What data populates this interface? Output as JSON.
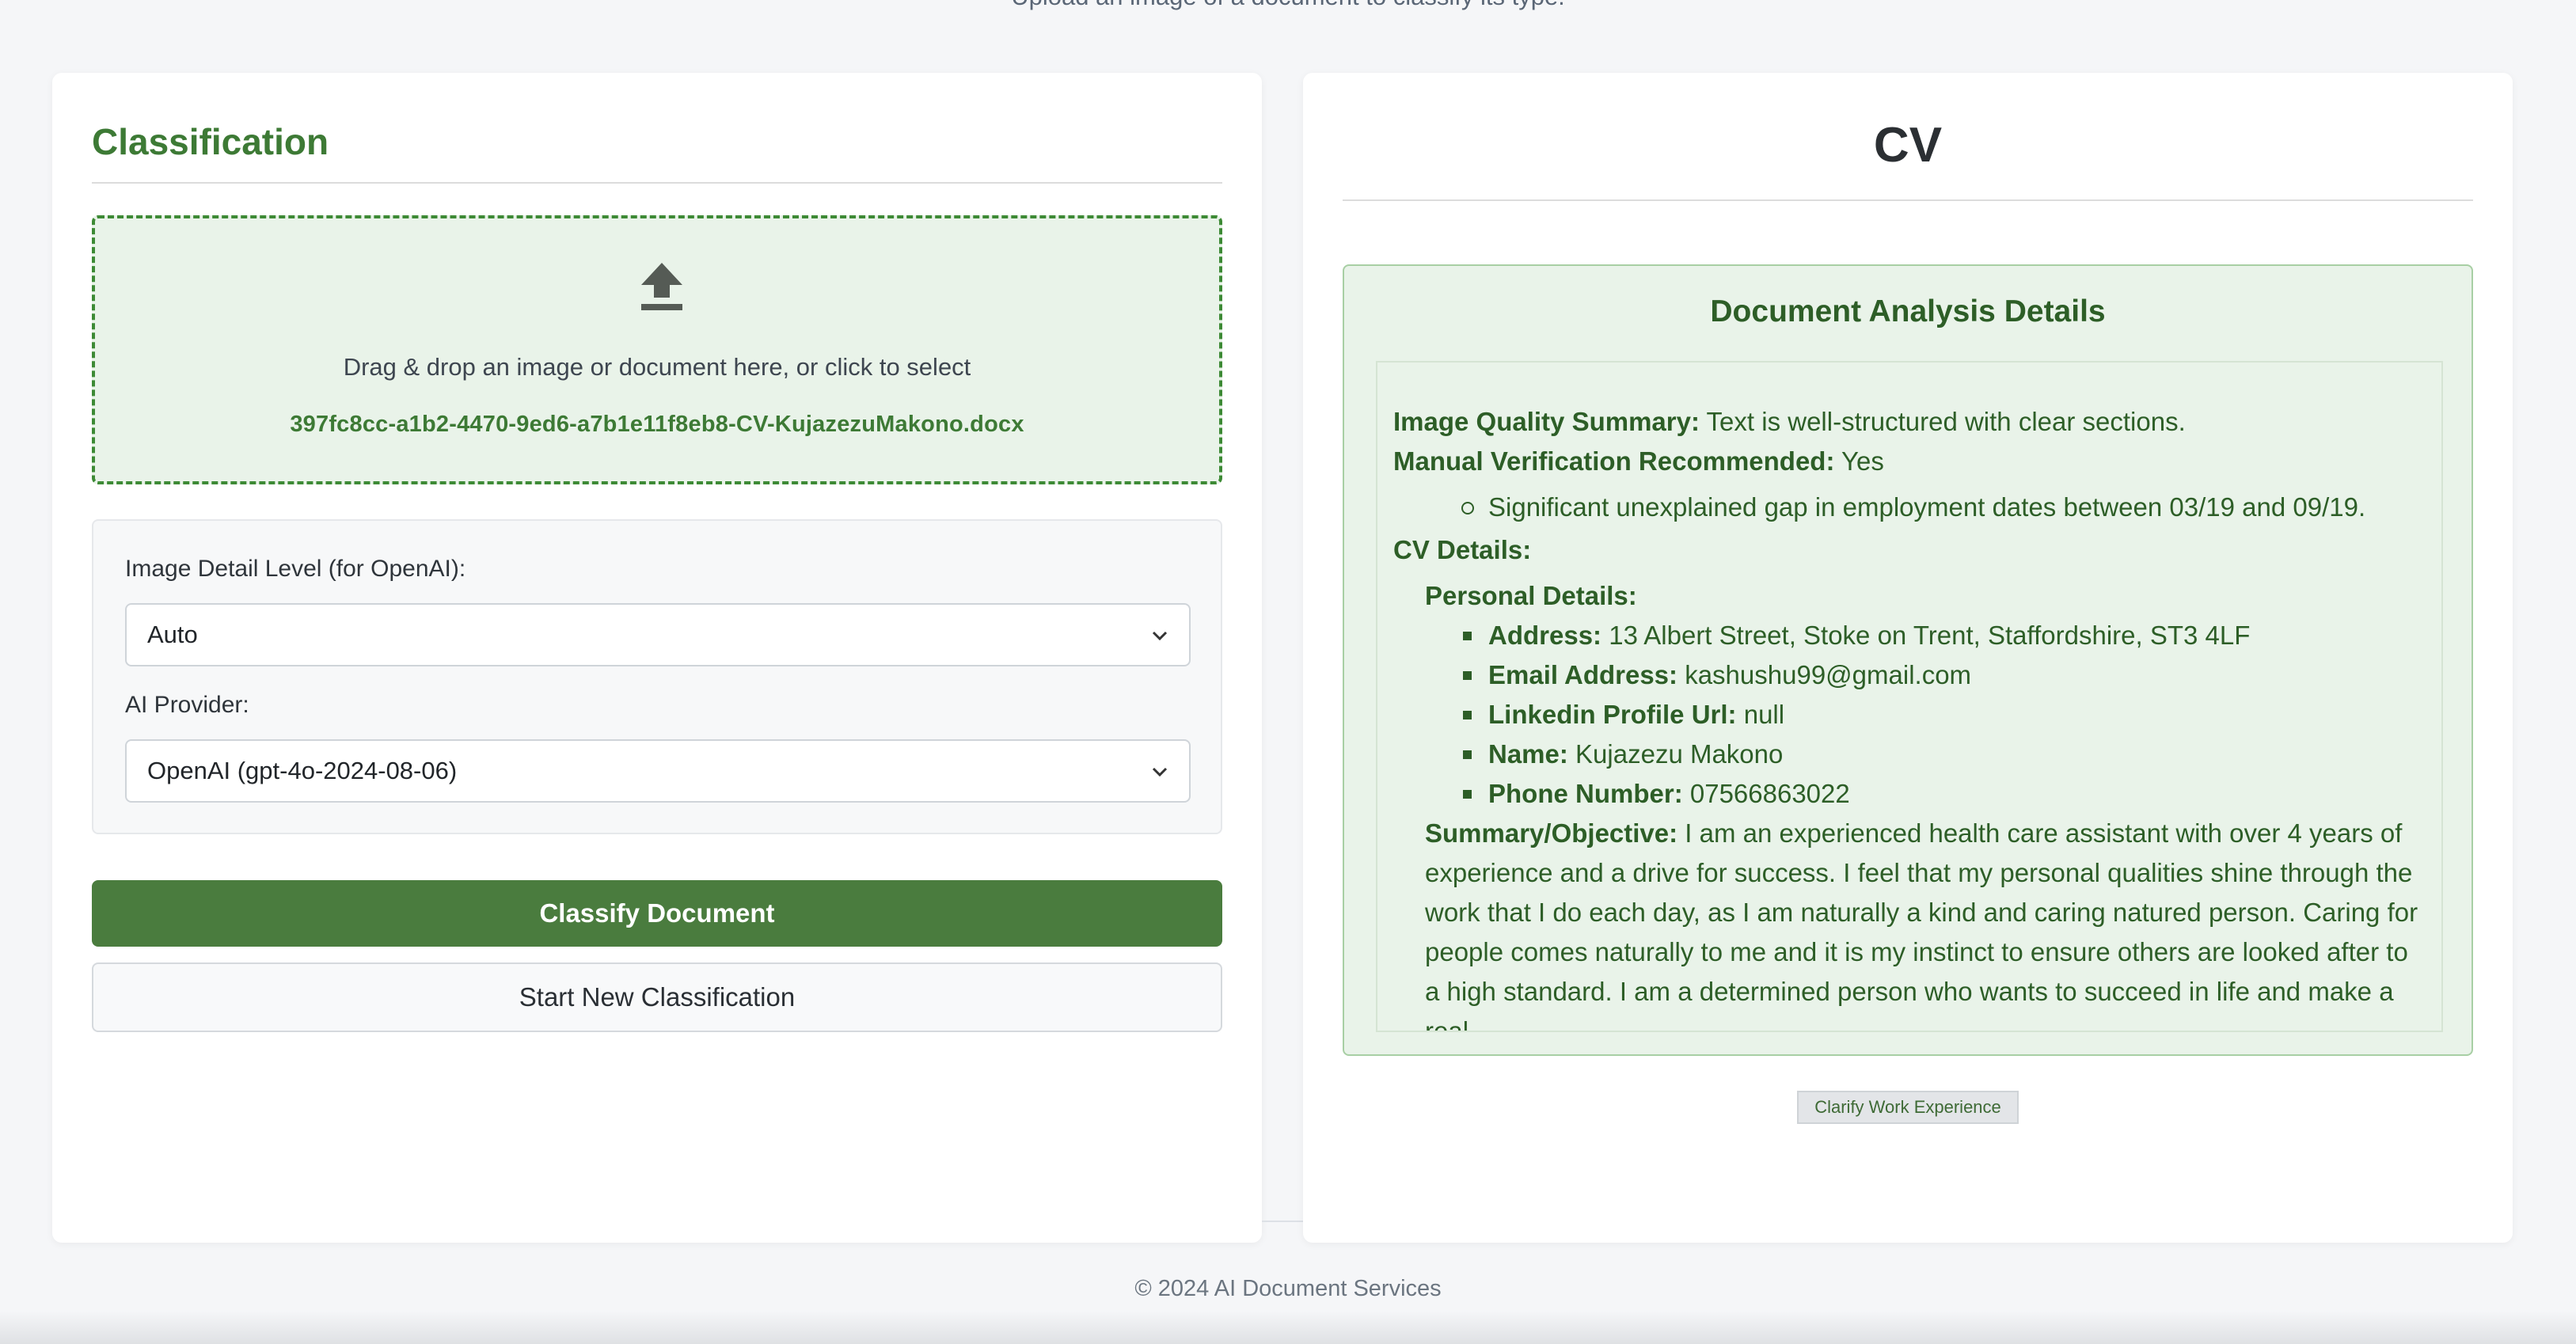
{
  "header": {
    "subtitle": "Upload an image of a document to classify its type."
  },
  "classification": {
    "title": "Classification",
    "dropzone": {
      "icon": "upload-icon",
      "prompt": "Drag & drop an image or document here, or click to select",
      "file_name": "397fc8cc-a1b2-4470-9ed6-a7b1e11f8eb8-CV-KujazezuMakono.docx"
    },
    "image_detail": {
      "label": "Image Detail Level (for OpenAI):",
      "selected": "Auto"
    },
    "ai_provider": {
      "label": "AI Provider:",
      "selected": "OpenAI (gpt-4o-2024-08-06)"
    },
    "classify_button": "Classify Document",
    "new_button": "Start New Classification"
  },
  "result": {
    "doc_type": "CV",
    "analysis_title": "Document Analysis Details",
    "quality": {
      "label": "Image Quality Summary:",
      "value": "Text is well-structured with clear sections."
    },
    "verification": {
      "label": "Manual Verification Recommended:",
      "value": "Yes"
    },
    "verification_reasons": [
      "Significant unexplained gap in employment dates between 03/19 and 09/19."
    ],
    "cv_details_label": "CV Details:",
    "personal_label": "Personal Details:",
    "personal": [
      {
        "label": "Address:",
        "value": "13 Albert Street, Stoke on Trent, Staffordshire, ST3 4LF"
      },
      {
        "label": "Email Address:",
        "value": "kashushu99@gmail.com"
      },
      {
        "label": "Linkedin Profile Url:",
        "value": "null"
      },
      {
        "label": "Name:",
        "value": "Kujazezu Makono"
      },
      {
        "label": "Phone Number:",
        "value": "07566863022"
      }
    ],
    "summary_label": "Summary/Objective:",
    "summary_text": "I am an experienced health care assistant with over 4 years of experience and a drive for success. I feel that my personal qualities shine through the work that I do each day, as I am naturally a kind and caring natured person. Caring for people comes naturally to me and it is my instinct to ensure others are looked after to a high standard. I am a determined person who wants to succeed in life and make a real",
    "clarify_button": "Clarify Work Experience"
  },
  "footer": {
    "text": "© 2024 AI Document Services"
  },
  "colors": {
    "accent": "#3d7a35",
    "button": "#4a7c3e",
    "panel": "#e9f3e9"
  }
}
